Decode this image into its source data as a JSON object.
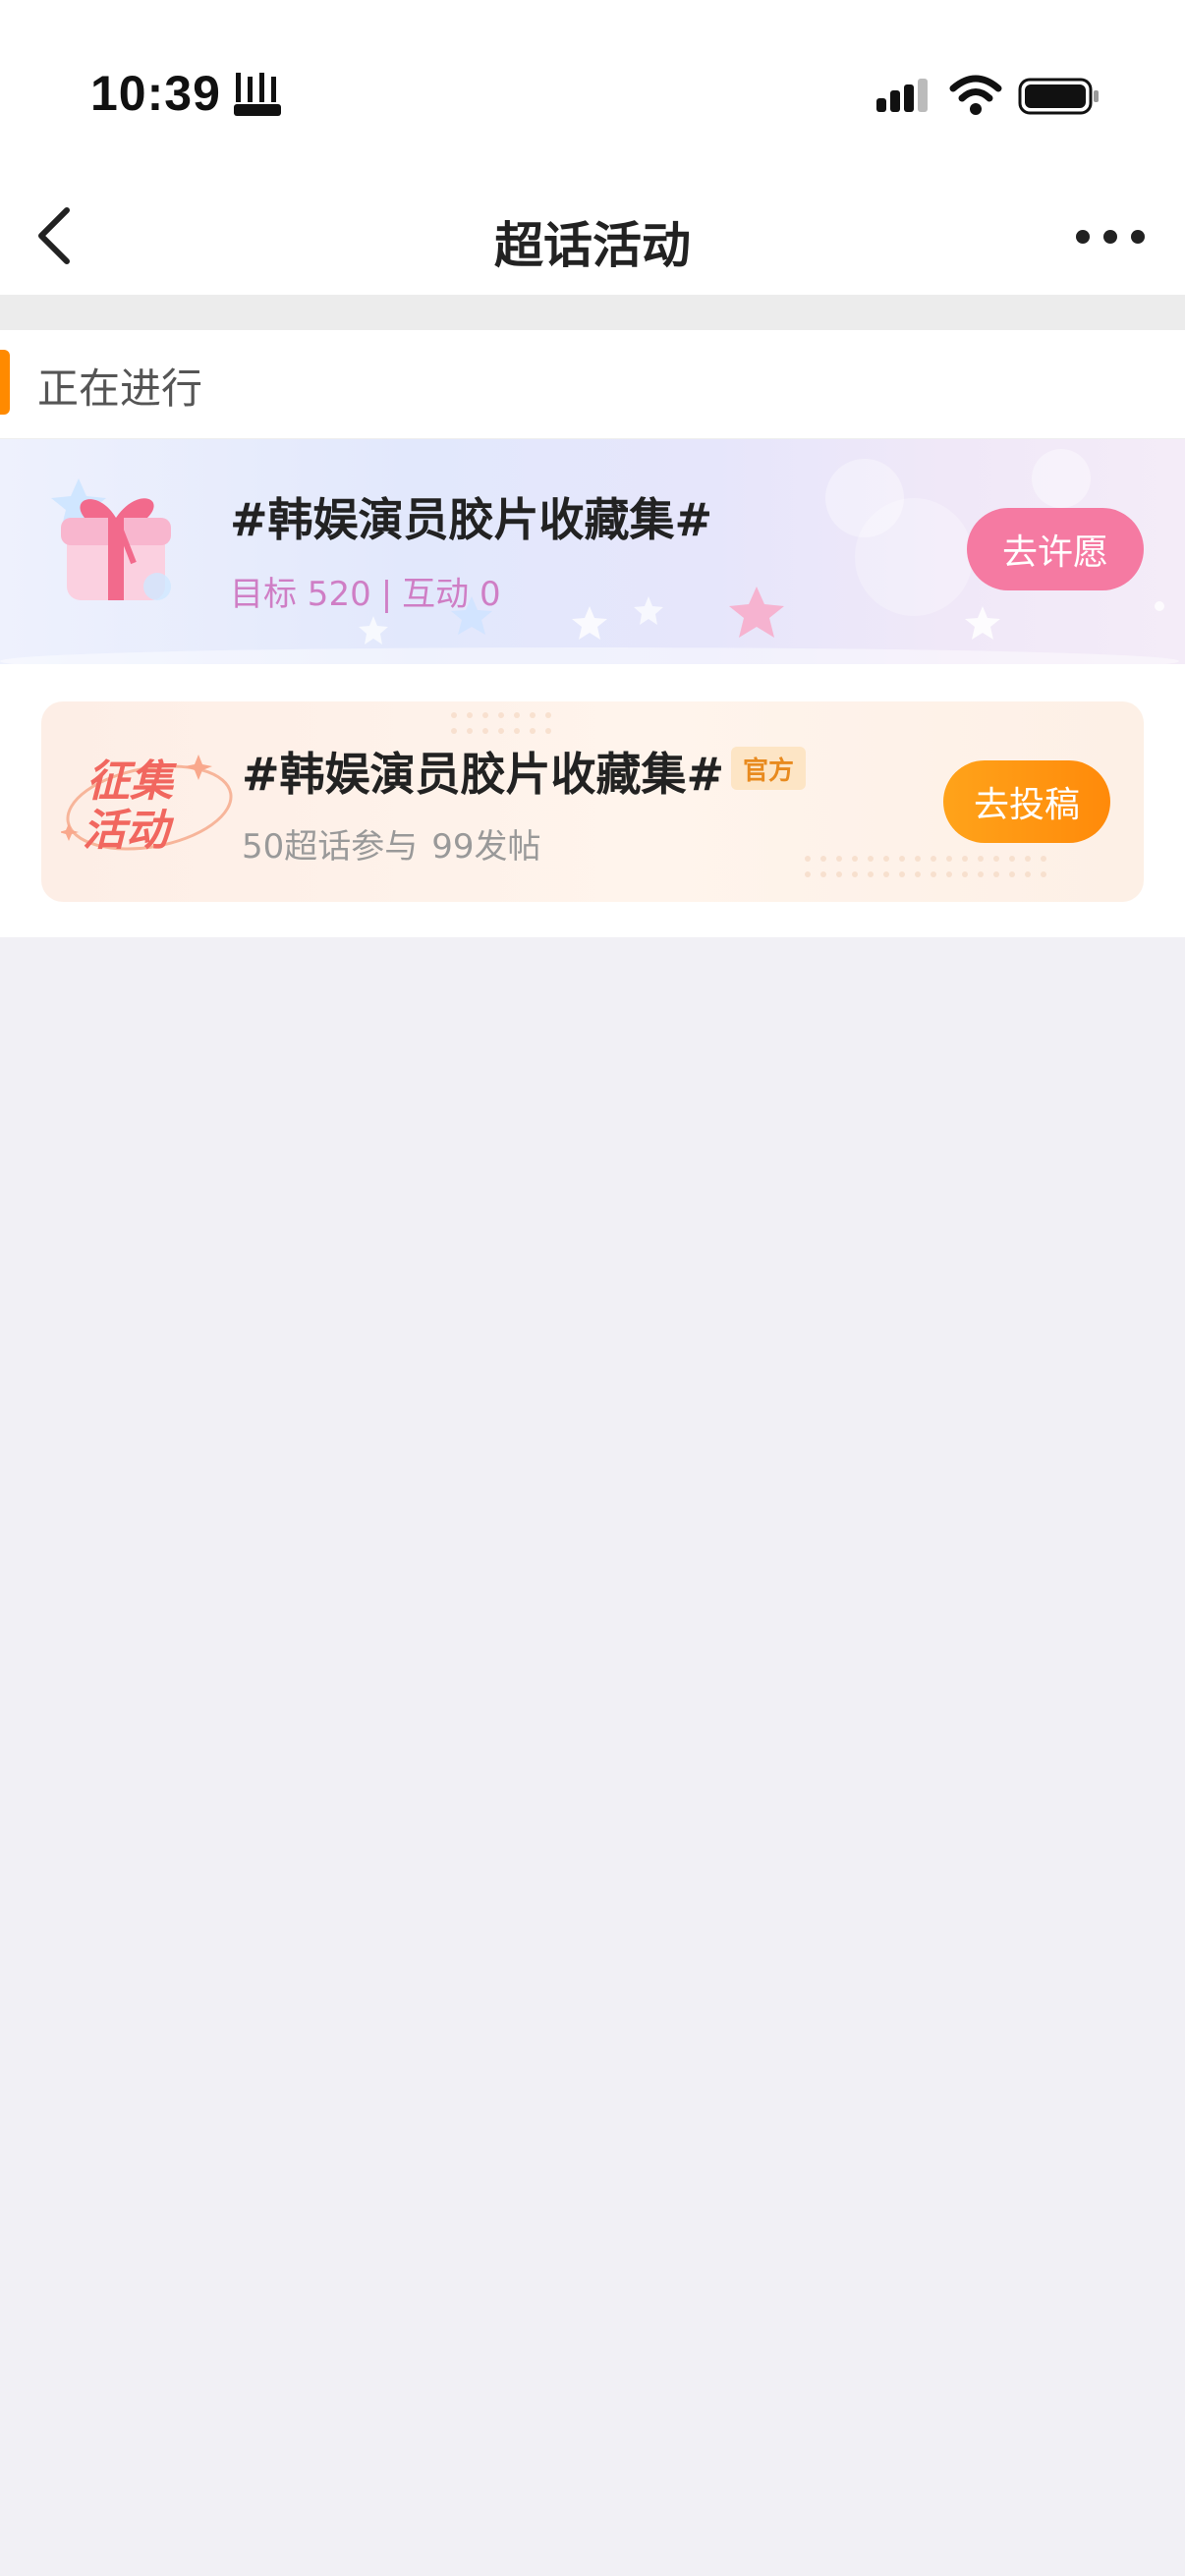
{
  "status_bar": {
    "time": "10:39",
    "extra_icon": "app-activity-icon",
    "signal_icon": "cellular-signal-icon",
    "wifi_icon": "wifi-icon",
    "battery_icon": "battery-icon"
  },
  "nav": {
    "title": "超话活动",
    "back_icon": "back-arrow-icon",
    "more_icon": "more-dots-icon"
  },
  "section": {
    "title": "正在进行",
    "accent_color": "#ff8a00"
  },
  "wish_activity": {
    "title": "#韩娱演员胶片收藏集#",
    "target_label": "目标 520",
    "separator": "|",
    "interaction_label": "互动 0",
    "button_label": "去许愿",
    "button_color": "#f57aa2",
    "art_icon": "gift-box-icon"
  },
  "collect_activity": {
    "title": "#韩娱演员胶片收藏集#",
    "official_tag": "官方",
    "participants": "50超话参与",
    "posts": "99发帖",
    "button_label": "去投稿",
    "button_color": "#ff9410",
    "badge_text_line1": "征集",
    "badge_text_line2": "活动"
  }
}
